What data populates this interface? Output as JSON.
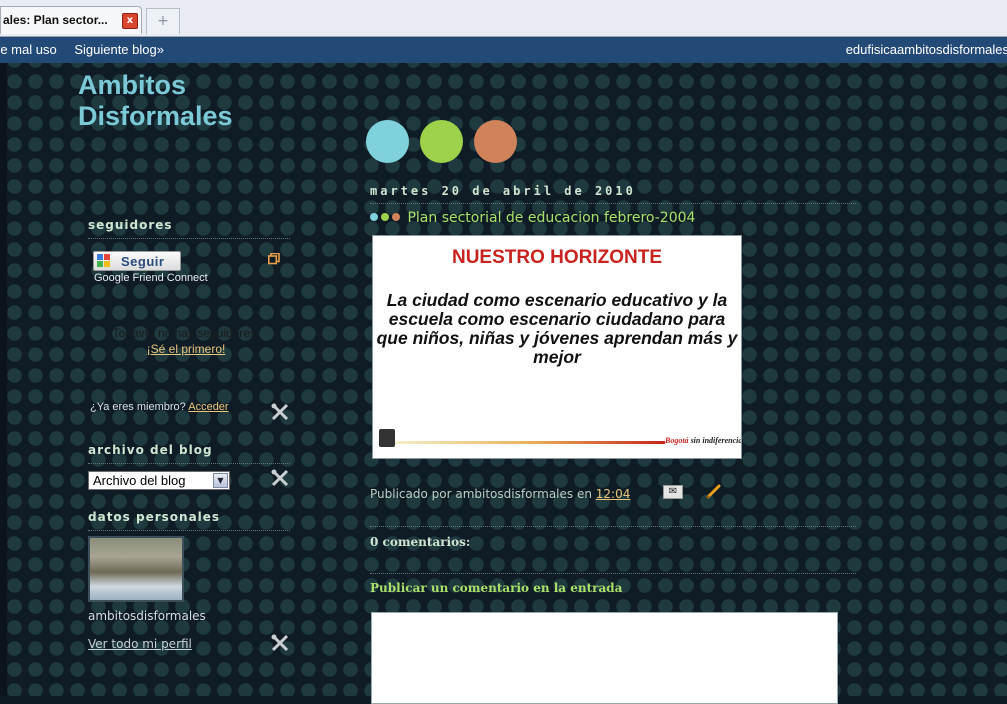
{
  "browser": {
    "tab_title": "ales: Plan sector...",
    "close_glyph": "x",
    "new_tab_glyph": "+"
  },
  "navbar": {
    "report_label": "re mal uso",
    "next_blog_label": "Siguiente blog»",
    "blog_address": "edufisicaambitosdisformales"
  },
  "blog": {
    "title": "Ambitos Disformales"
  },
  "decor_dots": [
    "#7fd2dc",
    "#9ed24a",
    "#d0825a"
  ],
  "sidebar": {
    "followers": {
      "heading": "seguidores",
      "follow_button": "Seguir",
      "gfc_label": "Google Friend Connect",
      "no_followers": "Todavía no hay seguidores.",
      "be_first": "¡Sé el primero!",
      "member_question": "¿Ya eres miembro?",
      "sign_in": "Acceder"
    },
    "archive": {
      "heading": "archivo del blog",
      "selected": "Archivo del blog"
    },
    "profile": {
      "heading": "datos personales",
      "name": "ambitosdisformales",
      "view_profile": "Ver todo mi perfil"
    }
  },
  "post": {
    "date": "martes 20 de abril de 2010",
    "title": "Plan sectorial de educacion febrero-2004",
    "image": {
      "heading": "NUESTRO HORIZONTE",
      "body": "La ciudad como escenario educativo y la escuela como escenario ciudadano para que niños, niñas y jóvenes aprendan más y mejor",
      "brand": "Bogotá",
      "brand_tail": "sin indiferencia"
    },
    "footer_prefix": "Publicado por ambitosdisformales en",
    "time": "12:04"
  },
  "comments": {
    "count_heading": "0 comentarios:",
    "publish_heading": "Publicar un comentario en la entrada"
  }
}
